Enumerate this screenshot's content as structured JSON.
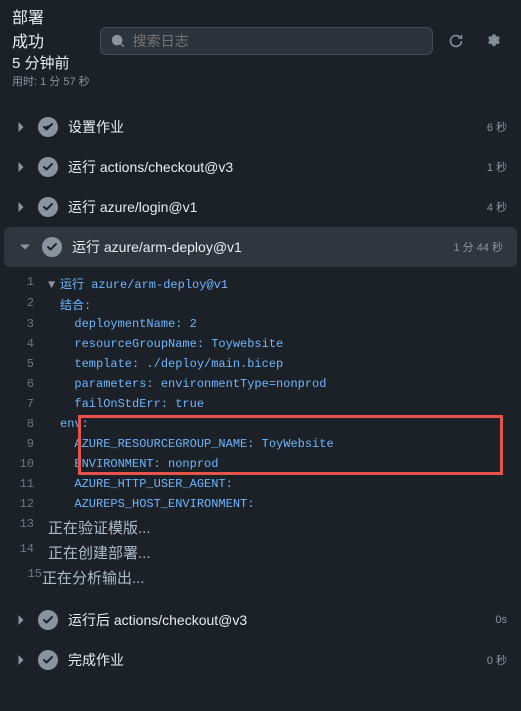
{
  "header": {
    "title": "部署",
    "status": "成功",
    "time_ago": "5 分钟前",
    "duration": "用时: 1 分 57 秒"
  },
  "search": {
    "placeholder": "搜索日志"
  },
  "steps": [
    {
      "name": "设置作业",
      "time": "6 秒"
    },
    {
      "name": "运行 actions/checkout@v3",
      "time": "1 秒"
    },
    {
      "name": "运行 azure/login@v1",
      "time": "4 秒"
    },
    {
      "name": "运行 azure/arm-deploy@v1",
      "time": "1 分 44 秒"
    },
    {
      "name": "运行后 actions/checkout@v3",
      "time": "0s"
    },
    {
      "name": "完成作业",
      "time": "0 秒"
    }
  ],
  "log": {
    "l1": "运行 azure/arm-deploy@v1",
    "l2": "结合:",
    "l3": "  deploymentName: 2",
    "l4": "  resourceGroupName: Toywebsite",
    "l5": "  template: ./deploy/main.bicep",
    "l6": "  parameters: environmentType=nonprod",
    "l7": "  failOnStdErr: true",
    "l8": "env:",
    "l9": "  AZURE_RESOURCEGROUP_NAME: ToyWebsite",
    "l10": "  ENVIRONMENT: nonprod",
    "l11": "  AZURE_HTTP_USER_AGENT:",
    "l12": "  AZUREPS_HOST_ENVIRONMENT:",
    "l13": "正在验证模版...",
    "l14": "正在创建部署...",
    "l15": "正在分析输出..."
  },
  "ln": {
    "n1": "1",
    "n2": "2",
    "n3": "3",
    "n4": "4",
    "n5": "5",
    "n6": "6",
    "n7": "7",
    "n8": "8",
    "n9": "9",
    "n10": "10",
    "n11": "11",
    "n12": "12",
    "n13": "13",
    "n14": "14",
    "n15": "15"
  }
}
